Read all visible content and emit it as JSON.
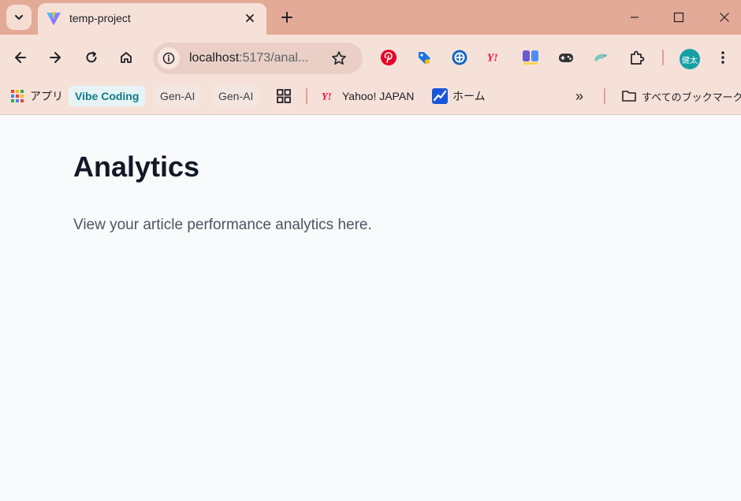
{
  "browser": {
    "tab": {
      "title": "temp-project",
      "favicon": "vite-logo-icon"
    },
    "address_bar": {
      "host": "localhost",
      "rest": ":5173/anal..."
    },
    "profile": {
      "initials": "健太"
    },
    "extensions": [
      "pinterest-icon",
      "tag-icon",
      "blue-circle-icon",
      "yahoo-icon",
      "translate-icon",
      "gamepad-icon",
      "dolphin-icon",
      "puzzle-icon"
    ]
  },
  "bookmarks": {
    "apps_label": "アプリ",
    "items": [
      {
        "label": "Vibe Coding"
      },
      {
        "label": "Gen-AI"
      },
      {
        "label": "Gen-AI"
      },
      {
        "label": "Yahoo! JAPAN"
      },
      {
        "label": "ホーム"
      }
    ],
    "overflow_label": "»",
    "all_bookmarks_label": "すべてのブックマーク"
  },
  "page": {
    "title": "Analytics",
    "description": "View your article performance analytics here."
  },
  "colors": {
    "tabstrip": "#e3aa97",
    "toolbar": "#f6e1d9",
    "page_background": "#f9fafb",
    "title_text": "#111827",
    "body_text": "#4b5563"
  }
}
